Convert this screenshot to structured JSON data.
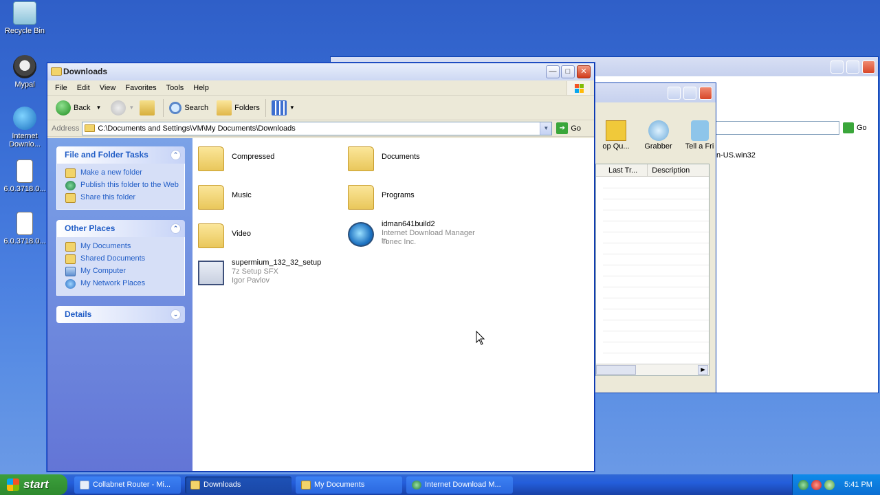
{
  "desktop": {
    "icons": [
      {
        "label": "Recycle Bin"
      },
      {
        "label": "Mypal"
      },
      {
        "label": "Internet Downlo..."
      },
      {
        "label": "6.0.3718.0..."
      },
      {
        "label": "6.0.3718.0..."
      }
    ]
  },
  "bg_window_idm": {
    "toolbar_labels": [
      "op Qu...",
      "Grabber",
      "Tell a Fri"
    ],
    "columns": [
      "Last Tr...",
      "Description"
    ]
  },
  "bg_window_mydocs": {
    "address_suffix": "n-US.win32",
    "go_label": "Go"
  },
  "window": {
    "title": "Downloads",
    "menu": [
      "File",
      "Edit",
      "View",
      "Favorites",
      "Tools",
      "Help"
    ],
    "toolbar": {
      "back_label": "Back",
      "search_label": "Search",
      "folders_label": "Folders"
    },
    "address": {
      "label": "Address",
      "value": "C:\\Documents and Settings\\VM\\My Documents\\Downloads",
      "go_label": "Go"
    },
    "tasks": {
      "file_folder": {
        "heading": "File and Folder Tasks",
        "items": [
          "Make a new folder",
          "Publish this folder to the Web",
          "Share this folder"
        ]
      },
      "other_places": {
        "heading": "Other Places",
        "items": [
          "My Documents",
          "Shared Documents",
          "My Computer",
          "My Network Places"
        ]
      },
      "details": {
        "heading": "Details"
      }
    },
    "files": [
      {
        "name": "Compressed",
        "type": "folder"
      },
      {
        "name": "Documents",
        "type": "folder"
      },
      {
        "name": "Music",
        "type": "folder"
      },
      {
        "name": "Programs",
        "type": "folder"
      },
      {
        "name": "Video",
        "type": "folder"
      },
      {
        "name": "idman641build2",
        "line2": "Internet Download Manager in...",
        "line3": "Tonec Inc.",
        "type": "exe"
      },
      {
        "name": "supermium_132_32_setup",
        "line2": "7z Setup SFX",
        "line3": "Igor Pavlov",
        "type": "exe"
      }
    ]
  },
  "taskbar": {
    "start_label": "start",
    "tasks": [
      "Collabnet Router - Mi...",
      "Downloads",
      "My Documents",
      "Internet Download M..."
    ],
    "clock": "5:41 PM"
  },
  "colors": {
    "link_blue": "#215dc6",
    "taskpane_top": "#7ba2e7",
    "taskpane_bottom": "#6375d6",
    "taskbar_blue": "#245edb",
    "start_green": "#3c9f3c"
  }
}
